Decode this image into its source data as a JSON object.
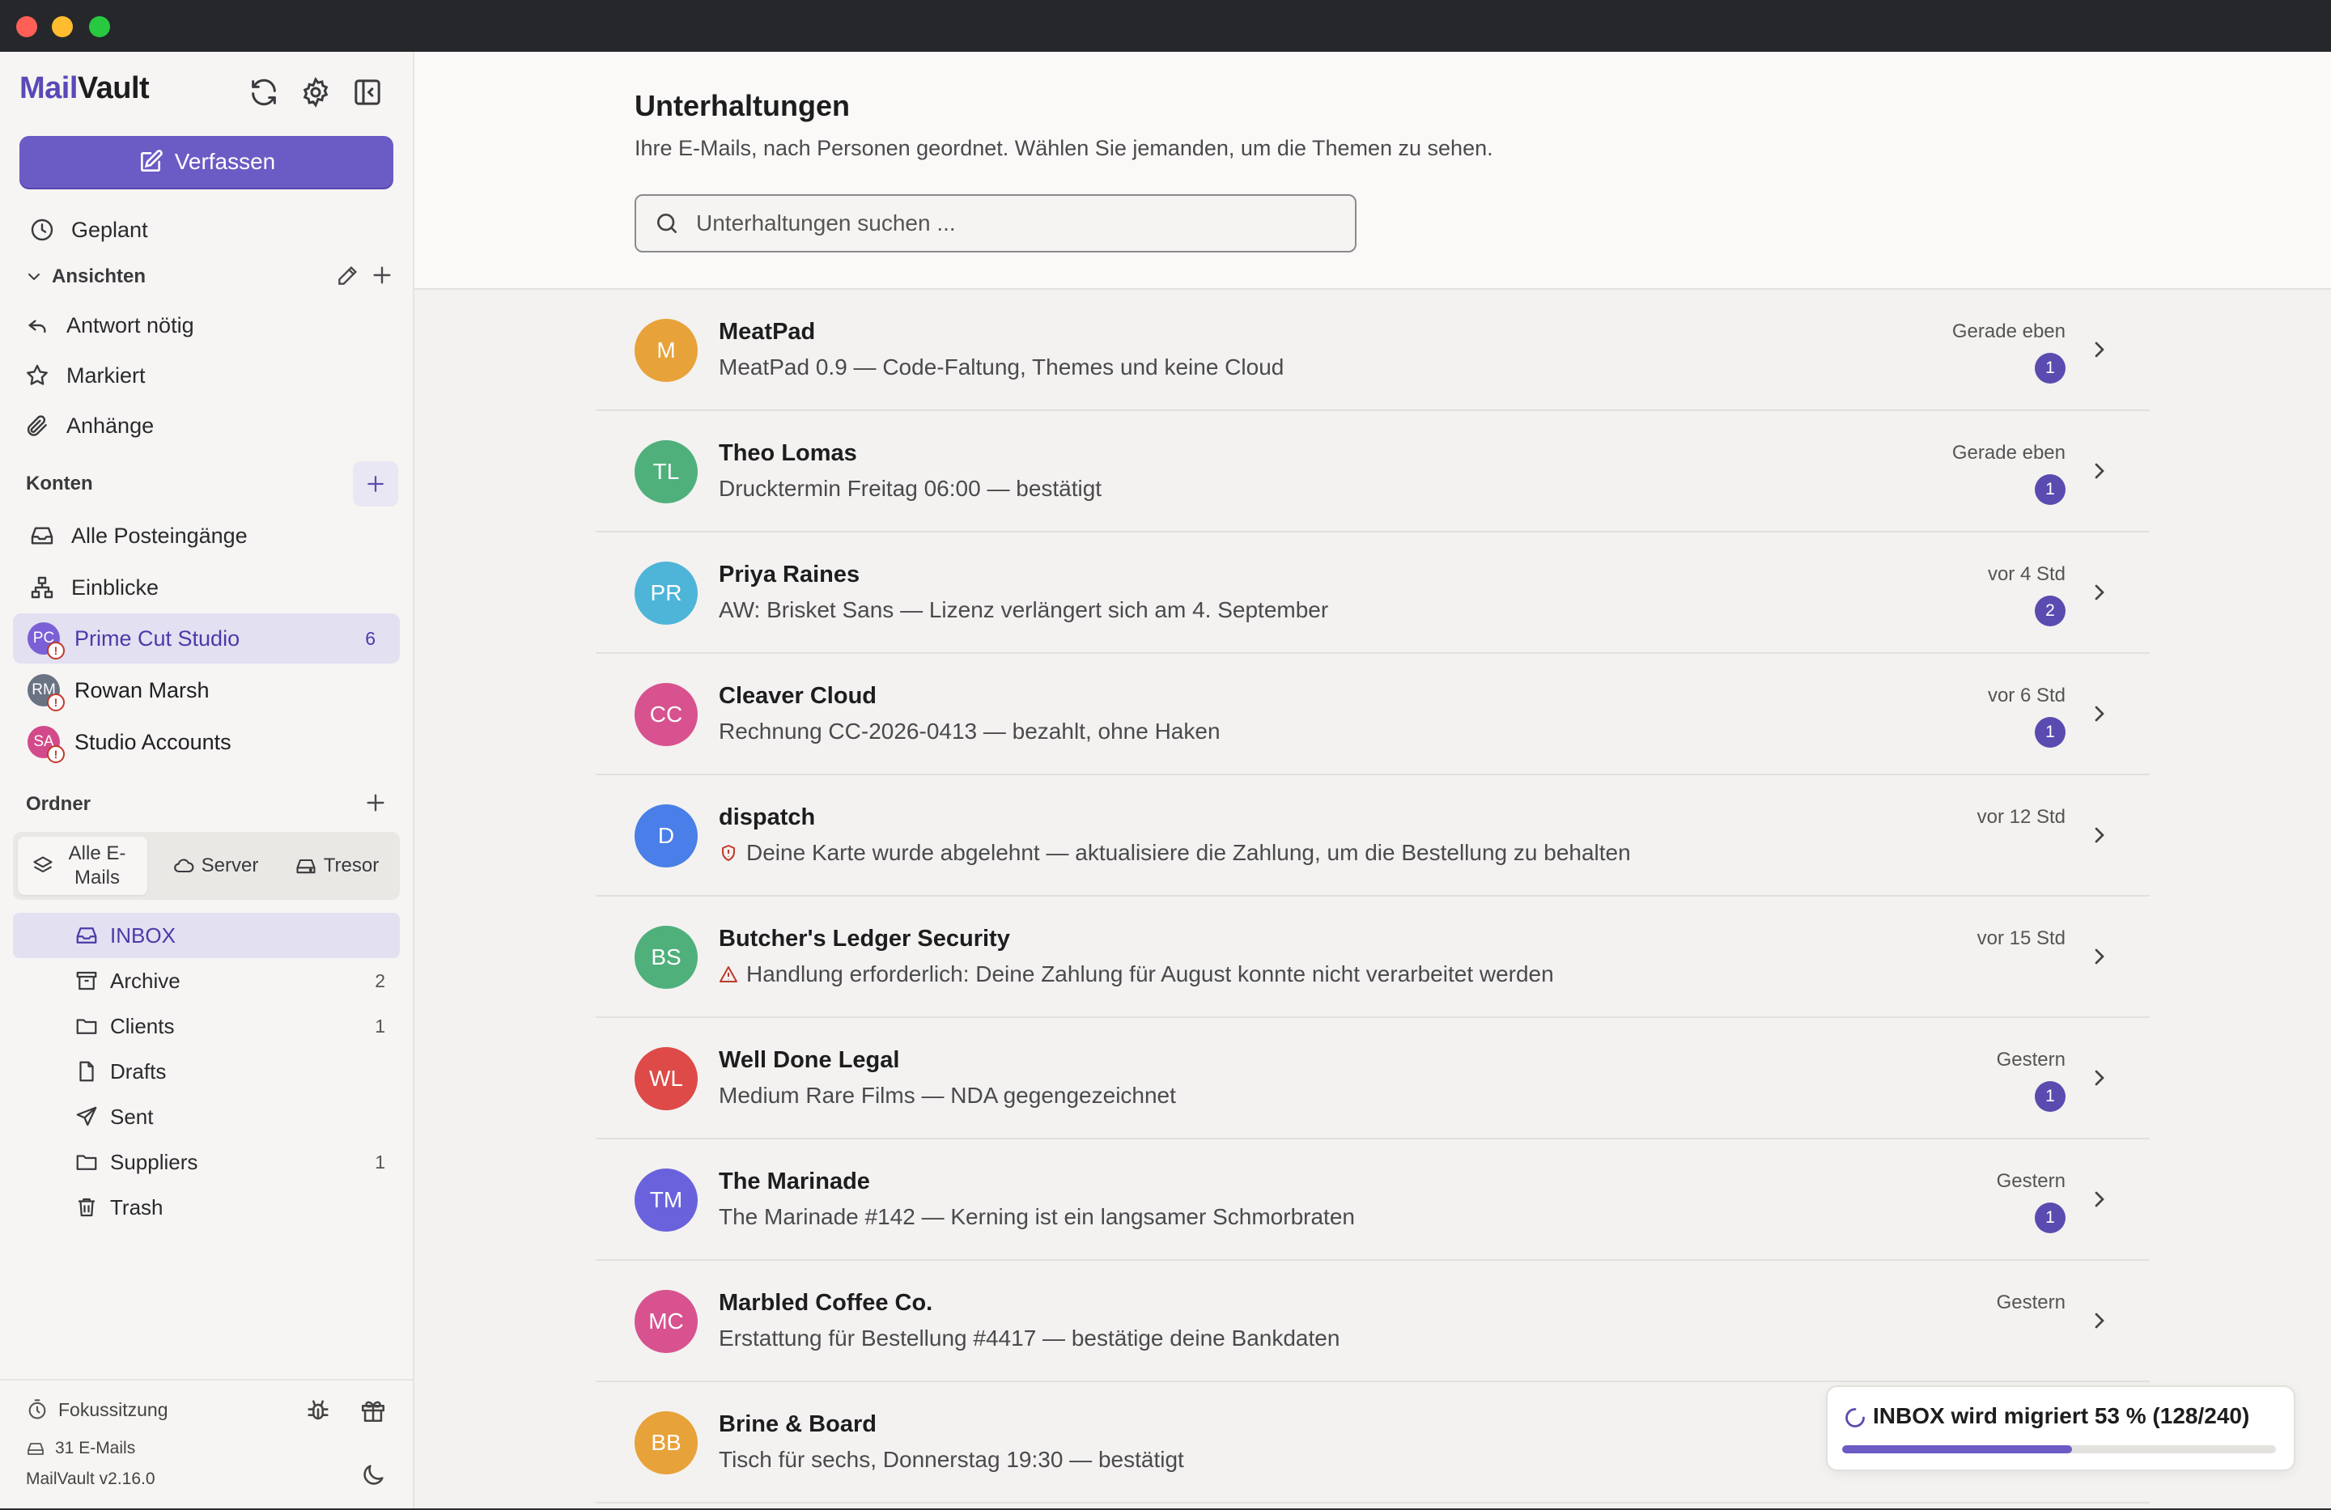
{
  "app": {
    "brand_part1": "Mail",
    "brand_part2": "Vault"
  },
  "sidebar": {
    "compose_label": "Verfassen",
    "scheduled_label": "Geplant",
    "views_label": "Ansichten",
    "views": [
      {
        "label": "Antwort nötig",
        "icon": "reply-icon"
      },
      {
        "label": "Markiert",
        "icon": "star-icon"
      },
      {
        "label": "Anhänge",
        "icon": "paperclip-icon"
      }
    ],
    "accounts_label": "Konten",
    "all_inboxes_label": "Alle Posteingänge",
    "insights_label": "Einblicke",
    "accounts": [
      {
        "initials": "PC",
        "name": "Prime Cut Studio",
        "count": "6",
        "color": "#7b5fd6",
        "selected": true
      },
      {
        "initials": "RM",
        "name": "Rowan Marsh",
        "count": "",
        "color": "#6a7383",
        "selected": false
      },
      {
        "initials": "SA",
        "name": "Studio Accounts",
        "count": "",
        "color": "#d24a8a",
        "selected": false
      }
    ],
    "folders_label": "Ordner",
    "segments": {
      "all": "Alle E-Mails",
      "server": "Server",
      "vault": "Tresor"
    },
    "folders": [
      {
        "name": "INBOX",
        "count": "",
        "icon": "inbox-icon",
        "selected": true
      },
      {
        "name": "Archive",
        "count": "2",
        "icon": "archive-icon",
        "selected": false
      },
      {
        "name": "Clients",
        "count": "1",
        "icon": "folder-icon",
        "selected": false
      },
      {
        "name": "Drafts",
        "count": "",
        "icon": "file-icon",
        "selected": false
      },
      {
        "name": "Sent",
        "count": "",
        "icon": "send-icon",
        "selected": false
      },
      {
        "name": "Suppliers",
        "count": "1",
        "icon": "folder-icon",
        "selected": false
      },
      {
        "name": "Trash",
        "count": "",
        "icon": "trash-icon",
        "selected": false
      }
    ],
    "footer": {
      "focus_label": "Fokussitzung",
      "mail_count": "31 E-Mails",
      "version": "MailVault v2.16.0"
    }
  },
  "main": {
    "title": "Unterhaltungen",
    "subtitle": "Ihre E-Mails, nach Personen geordnet. Wählen Sie jemanden, um die Themen zu sehen.",
    "search_placeholder": "Unterhaltungen suchen ...",
    "conversations": [
      {
        "initials": "M",
        "name": "MeatPad",
        "subject": "MeatPad 0.9 — Code-Faltung, Themes und keine Cloud",
        "time": "Gerade eben",
        "badge": "1",
        "color": "#e8a23a",
        "flag": ""
      },
      {
        "initials": "TL",
        "name": "Theo Lomas",
        "subject": "Drucktermin Freitag 06:00 — bestätigt",
        "time": "Gerade eben",
        "badge": "1",
        "color": "#4fb07c",
        "flag": ""
      },
      {
        "initials": "PR",
        "name": "Priya Raines",
        "subject": "AW: Brisket Sans — Lizenz verlängert sich am 4. September",
        "time": "vor 4 Std",
        "badge": "2",
        "color": "#4eb4d8",
        "flag": ""
      },
      {
        "initials": "CC",
        "name": "Cleaver Cloud",
        "subject": "Rechnung CC-2026-0413 — bezahlt, ohne Haken",
        "time": "vor 6 Std",
        "badge": "1",
        "color": "#d8528f",
        "flag": ""
      },
      {
        "initials": "D",
        "name": "dispatch",
        "subject": "Deine Karte wurde abgelehnt — aktualisiere die Zahlung, um die Bestellung zu behalten",
        "time": "vor 12 Std",
        "badge": "",
        "color": "#4a7ee8",
        "flag": "shield"
      },
      {
        "initials": "BS",
        "name": "Butcher's Ledger Security",
        "subject": "Handlung erforderlich: Deine Zahlung für August konnte nicht verarbeitet werden",
        "time": "vor 15 Std",
        "badge": "",
        "color": "#4fb07c",
        "flag": "warning"
      },
      {
        "initials": "WL",
        "name": "Well Done Legal",
        "subject": "Medium Rare Films — NDA gegengezeichnet",
        "time": "Gestern",
        "badge": "1",
        "color": "#dd4a47",
        "flag": ""
      },
      {
        "initials": "TM",
        "name": "The Marinade",
        "subject": "The Marinade #142 — Kerning ist ein langsamer Schmorbraten",
        "time": "Gestern",
        "badge": "1",
        "color": "#6a62dc",
        "flag": ""
      },
      {
        "initials": "MC",
        "name": "Marbled Coffee Co.",
        "subject": "Erstattung für Bestellung #4417 — bestätige deine Bankdaten",
        "time": "Gestern",
        "badge": "",
        "color": "#d8528f",
        "flag": ""
      },
      {
        "initials": "BB",
        "name": "Brine & Board",
        "subject": "Tisch für sechs, Donnerstag 19:30 — bestätigt",
        "time": "",
        "badge": "",
        "color": "#e8a23a",
        "flag": ""
      }
    ]
  },
  "migration": {
    "text": "INBOX wird migriert 53 % (128/240)",
    "progress": 0.53
  },
  "colors": {
    "accent": "#6b5bc4",
    "selected_bg": "#e3e0f2",
    "badge": "#5a4bb0",
    "danger": "#c0392b"
  }
}
